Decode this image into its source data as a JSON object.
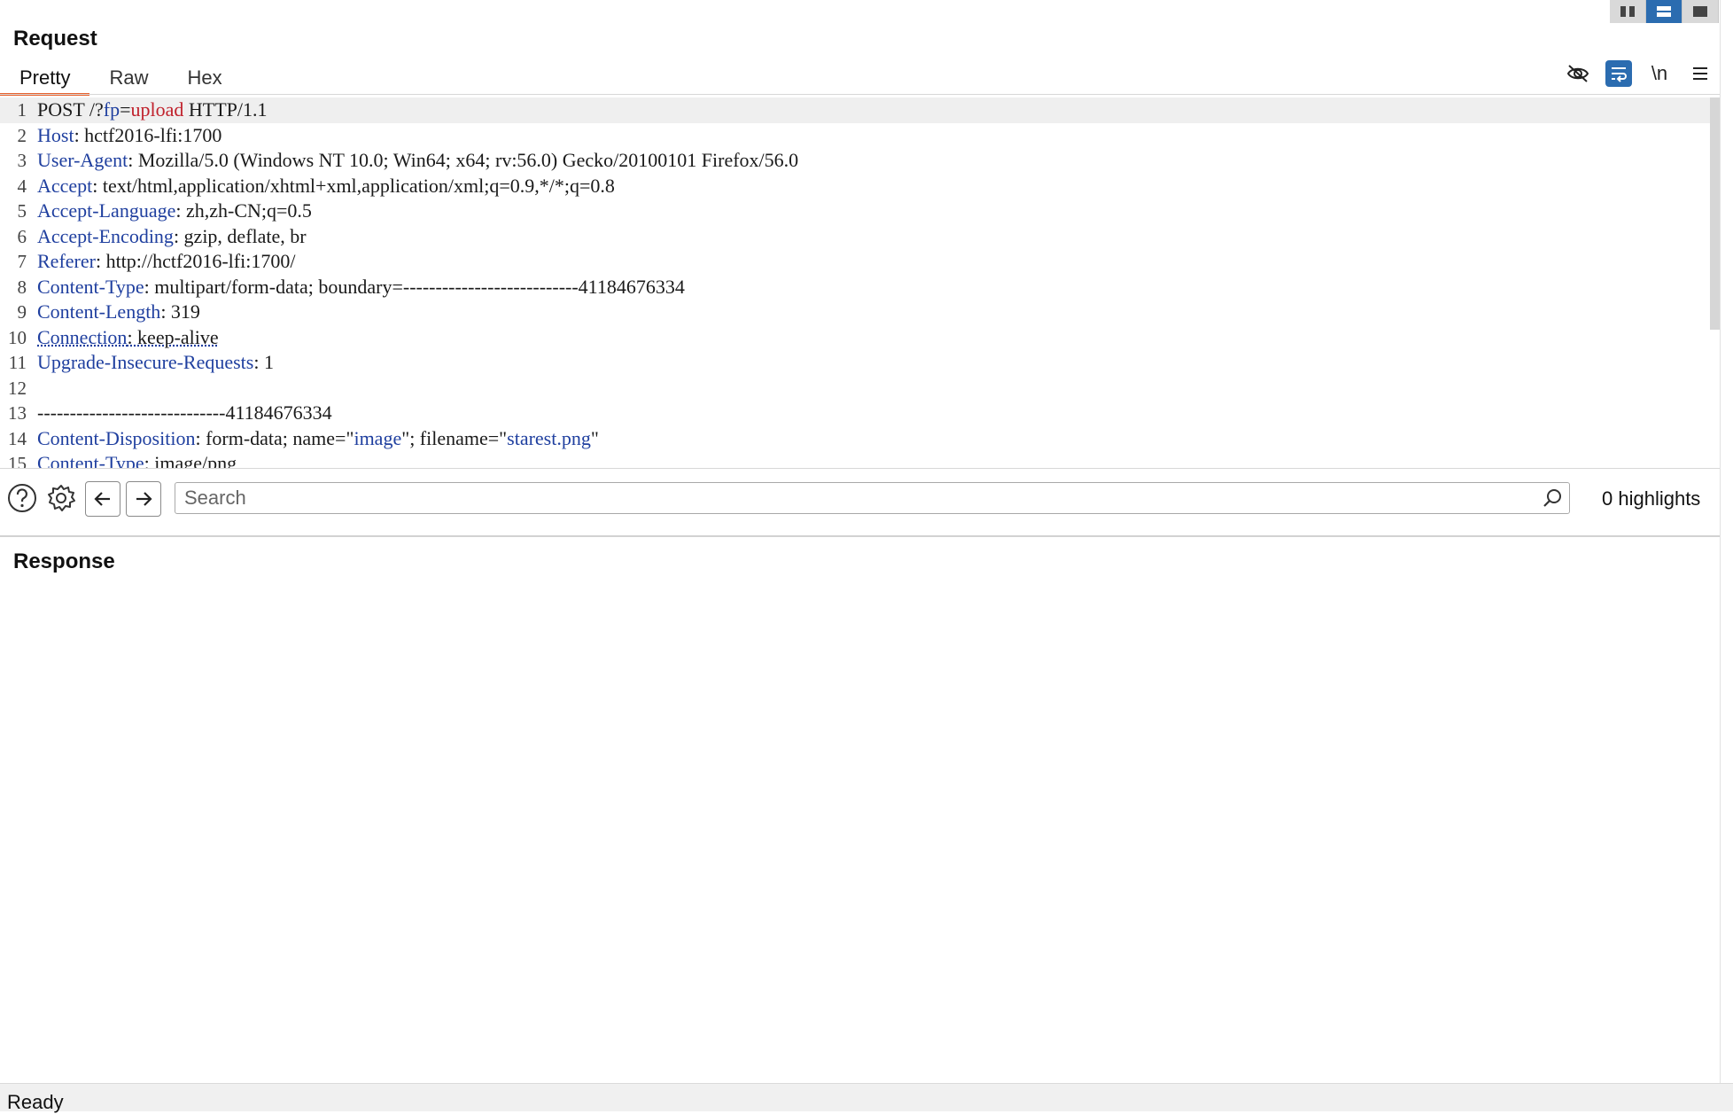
{
  "request": {
    "title": "Request",
    "tabs": [
      {
        "label": "Pretty",
        "active": true
      },
      {
        "label": "Raw",
        "active": false
      },
      {
        "label": "Hex",
        "active": false
      }
    ],
    "toolbar_icons": [
      "hide-eye-icon",
      "word-wrap-icon",
      "newline-icon",
      "menu-icon"
    ],
    "newline_label": "\\n",
    "lines": [
      {
        "n": "1",
        "parts": [
          [
            "v",
            "POST /?"
          ],
          [
            "k",
            "fp"
          ],
          [
            "v",
            "="
          ],
          [
            "red",
            "upload"
          ],
          [
            "v",
            " HTTP/1.1"
          ]
        ]
      },
      {
        "n": "2",
        "parts": [
          [
            "k",
            "Host"
          ],
          [
            "v",
            ": hctf2016-lfi:1700"
          ]
        ]
      },
      {
        "n": "3",
        "parts": [
          [
            "k",
            "User-Agent"
          ],
          [
            "v",
            ": Mozilla/5.0 (Windows NT 10.0; Win64; x64; rv:56.0) Gecko/20100101 Firefox/56.0"
          ]
        ]
      },
      {
        "n": "4",
        "parts": [
          [
            "k",
            "Accept"
          ],
          [
            "v",
            ": text/html,application/xhtml+xml,application/xml;q=0.9,*/*;q=0.8"
          ]
        ]
      },
      {
        "n": "5",
        "parts": [
          [
            "k",
            "Accept-Language"
          ],
          [
            "v",
            ": zh,zh-CN;q=0.5"
          ]
        ]
      },
      {
        "n": "6",
        "parts": [
          [
            "k",
            "Accept-Encoding"
          ],
          [
            "v",
            ": gzip, deflate, br"
          ]
        ]
      },
      {
        "n": "7",
        "parts": [
          [
            "k",
            "Referer"
          ],
          [
            "v",
            ": http://hctf2016-lfi:1700/"
          ]
        ]
      },
      {
        "n": "8",
        "parts": [
          [
            "k",
            "Content-Type"
          ],
          [
            "v",
            ": multipart/form-data; boundary=---------------------------41184676334"
          ]
        ]
      },
      {
        "n": "9",
        "parts": [
          [
            "k",
            "Content-Length"
          ],
          [
            "v",
            ": 319"
          ]
        ]
      },
      {
        "n": "10",
        "parts": [
          [
            "uk",
            "Connection"
          ],
          [
            "uv",
            ": keep-alive"
          ]
        ]
      },
      {
        "n": "11",
        "parts": [
          [
            "k",
            "Upgrade-Insecure-Requests"
          ],
          [
            "v",
            ": 1"
          ]
        ]
      },
      {
        "n": "12",
        "parts": [
          [
            "v",
            ""
          ]
        ]
      },
      {
        "n": "13",
        "parts": [
          [
            "v",
            "-----------------------------41184676334"
          ]
        ]
      },
      {
        "n": "14",
        "parts": [
          [
            "k",
            "Content-Disposition"
          ],
          [
            "v",
            ": form-data; name=\""
          ],
          [
            "blue",
            "image"
          ],
          [
            "v",
            "\"; filename=\""
          ],
          [
            "blue",
            "starest.png"
          ],
          [
            "v",
            "\""
          ]
        ]
      },
      {
        "n": "15",
        "parts": [
          [
            "k",
            "Content-Type"
          ],
          [
            "v",
            ": image/png"
          ]
        ]
      }
    ]
  },
  "search": {
    "placeholder": "Search",
    "value": "",
    "highlights": "0 highlights"
  },
  "response": {
    "title": "Response"
  },
  "status": {
    "text": "Ready"
  },
  "colors": {
    "accent_tab": "#e8612c",
    "active_icon": "#2b6cb0",
    "key_color": "#1f3f9f",
    "param_value": "#c0212c"
  }
}
